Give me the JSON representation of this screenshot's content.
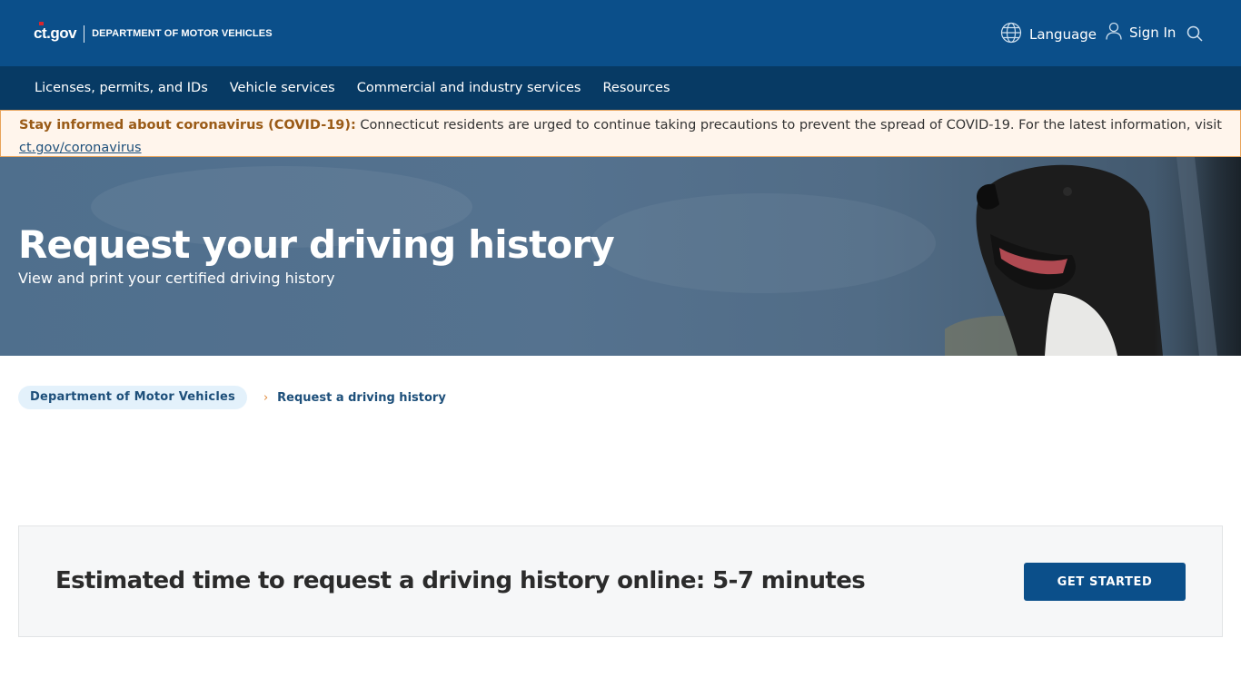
{
  "header": {
    "logo_text": "ct.gov",
    "department": "DEPARTMENT OF MOTOR VEHICLES",
    "language_label": "Language",
    "signin_label": "Sign In"
  },
  "nav": {
    "items": [
      {
        "label": "Licenses, permits, and IDs"
      },
      {
        "label": "Vehicle services"
      },
      {
        "label": "Commercial and industry services"
      },
      {
        "label": "Resources"
      }
    ]
  },
  "alert": {
    "title": "Stay informed about coronavirus (COVID-19):",
    "body": " Connecticut residents are urged to continue taking precautions to prevent the spread of COVID-19. For the latest information, visit",
    "link_text": "ct.gov/coronavirus"
  },
  "hero": {
    "title": "Request your driving history",
    "subtitle": "View and print your certified driving history"
  },
  "breadcrumb": {
    "parent": "Department of Motor Vehicles",
    "separator": "›",
    "current": "Request a driving history"
  },
  "time_card": {
    "text": "Estimated time to request a driving history online: 5-7 minutes",
    "button_label": "GET STARTED"
  },
  "colors": {
    "header_bg": "#0b4f8a",
    "nav_bg": "#073a64",
    "alert_bg": "#fff5ec",
    "alert_border": "#e8a35a",
    "button_bg": "#0b4f8a"
  }
}
